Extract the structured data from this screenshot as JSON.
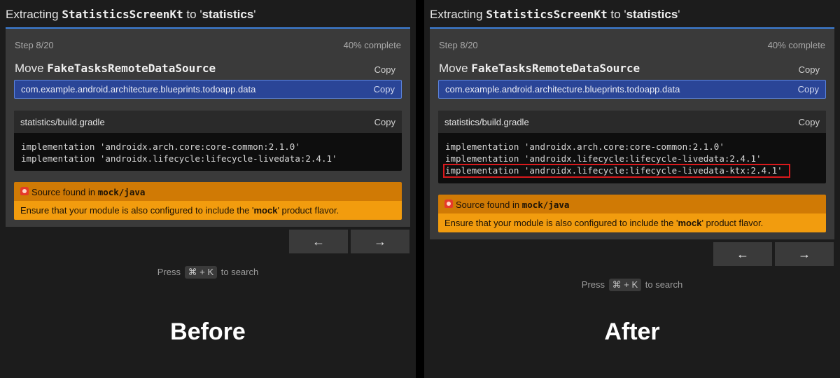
{
  "before": {
    "title": {
      "prefix": "Extracting ",
      "class_name": "StatisticsScreenKt",
      "middle": " to '",
      "target": "statistics",
      "suffix": "'"
    },
    "step": "Step 8/20",
    "progress_text": "40% complete",
    "progress_percent": 40,
    "move": {
      "prefix": "Move ",
      "class_name": "FakeTasksRemoteDataSource",
      "copy_label": "Copy"
    },
    "package": {
      "text": "com.example.android.architecture.blueprints.todoapp.data",
      "copy_label": "Copy"
    },
    "gradle": {
      "file": "statistics/build.gradle",
      "copy_label": "Copy",
      "lines": [
        "implementation 'androidx.arch.core:core-common:2.1.0'",
        "implementation 'androidx.lifecycle:lifecycle-livedata:2.4.1'"
      ]
    },
    "warning": {
      "icon": "siren-icon",
      "prefix": "Source found in ",
      "path": "mock/java",
      "body_prefix": "Ensure that your module is also configured to include the '",
      "flavor": "mock",
      "body_suffix": "' product flavor."
    },
    "nav": {
      "prev": "←",
      "next": "→"
    },
    "search_hint": {
      "prefix": "Press ",
      "shortcut": "⌘ + K",
      "suffix": " to search"
    },
    "label": "Before"
  },
  "after": {
    "title": {
      "prefix": "Extracting ",
      "class_name": "StatisticsScreenKt",
      "middle": " to '",
      "target": "statistics",
      "suffix": "'"
    },
    "step": "Step 8/20",
    "progress_text": "40% complete",
    "progress_percent": 40,
    "move": {
      "prefix": "Move ",
      "class_name": "FakeTasksRemoteDataSource",
      "copy_label": "Copy"
    },
    "package": {
      "text": "com.example.android.architecture.blueprints.todoapp.data",
      "copy_label": "Copy"
    },
    "gradle": {
      "file": "statistics/build.gradle",
      "copy_label": "Copy",
      "lines": [
        "implementation 'androidx.arch.core:core-common:2.1.0'",
        "implementation 'androidx.lifecycle:lifecycle-livedata:2.4.1'",
        "implementation 'androidx.lifecycle:lifecycle-livedata-ktx:2.4.1'"
      ],
      "highlighted_line": 3
    },
    "warning": {
      "icon": "siren-icon",
      "prefix": "Source found in ",
      "path": "mock/java",
      "body_prefix": "Ensure that your module is also configured to include the '",
      "flavor": "mock",
      "body_suffix": "' product flavor."
    },
    "nav": {
      "prev": "←",
      "next": "→"
    },
    "search_hint": {
      "prefix": "Press ",
      "shortcut": "⌘ + K",
      "suffix": " to search"
    },
    "label": "After"
  },
  "colors": {
    "accent": "#3d7fd8",
    "package_bg": "#2a4597",
    "warning_header": "#d07a05",
    "warning_body": "#f29c0e",
    "highlight_border": "#d9191c"
  }
}
